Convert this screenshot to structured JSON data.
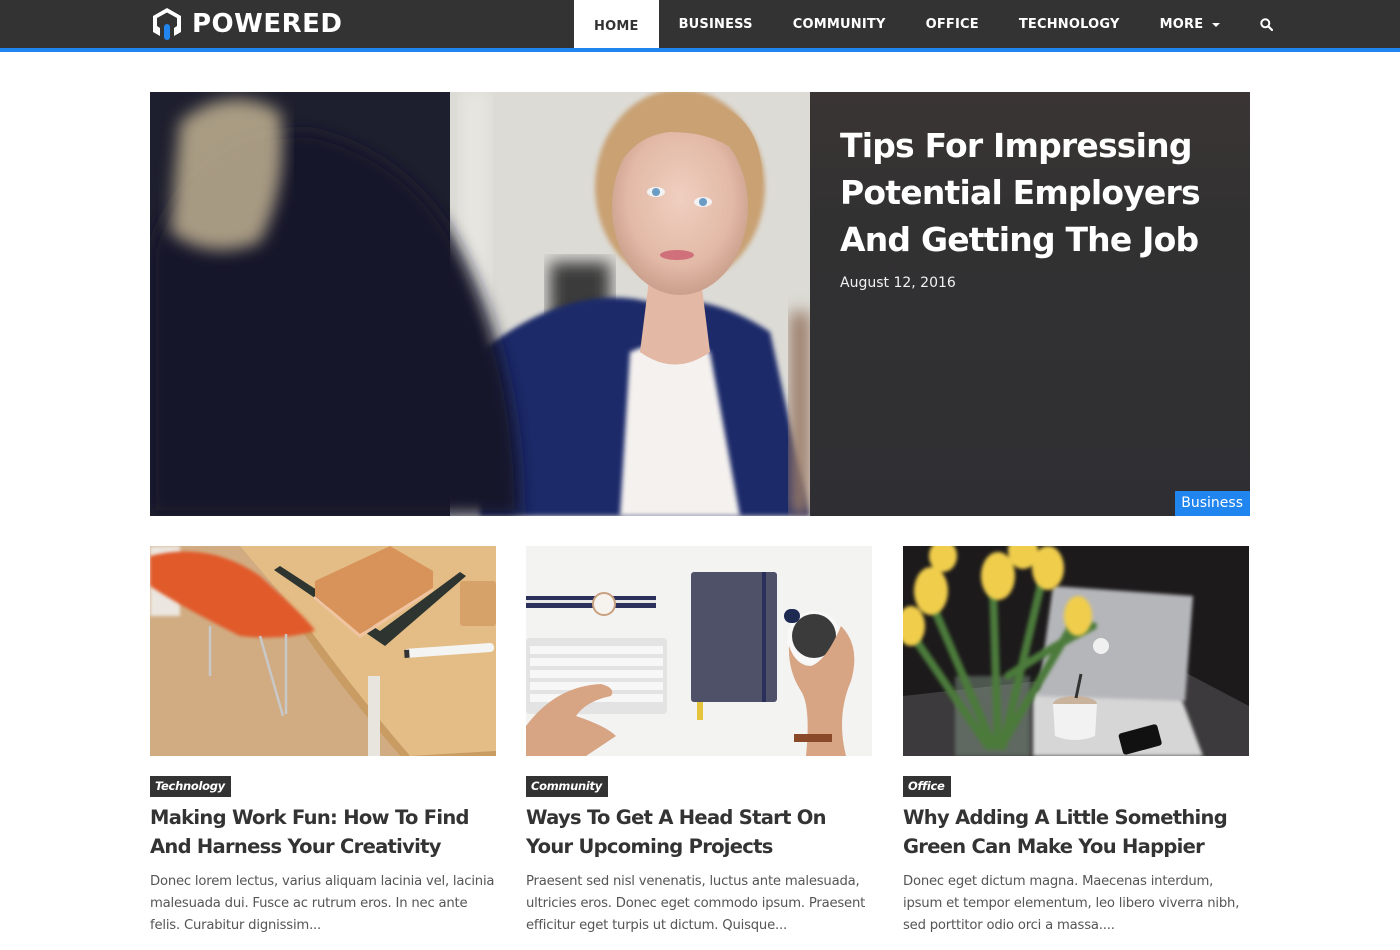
{
  "site": {
    "logo_text": "POWERED",
    "accent_color": "#2185f0",
    "header_bg": "#333333"
  },
  "nav": {
    "items": [
      {
        "label": "HOME",
        "active": true
      },
      {
        "label": "BUSINESS",
        "active": false
      },
      {
        "label": "COMMUNITY",
        "active": false
      },
      {
        "label": "OFFICE",
        "active": false
      },
      {
        "label": "TECHNOLOGY",
        "active": false
      },
      {
        "label": "MORE",
        "active": false,
        "has_dropdown": true
      }
    ],
    "search_icon": "search-icon",
    "dropdown_icon": "caret-down-icon"
  },
  "hero": {
    "image": "photo-woman-in-job-interview",
    "title": "Tips For Impressing Potential Employers And Getting The Job",
    "date": "August 12, 2016",
    "category": "Business"
  },
  "cards": [
    {
      "image": "photo-orange-chair-and-wooden-desk",
      "category": "Technology",
      "title": "Making Work Fun: How To Find And Harness Your Creativity",
      "excerpt": "Donec lorem lectus, varius aliquam lacinia vel, lacinia malesuada dui. Fusce ac rutrum eros. In nec ante felis. Curabitur dignissim..."
    },
    {
      "image": "photo-keyboard-notebook-coffee",
      "category": "Community",
      "title": "Ways To Get A Head Start On Your Upcoming Projects",
      "excerpt": "Praesent sed nisl venenatis, luctus ante malesuada, ultricies eros. Donec eget commodo ipsum. Praesent efficitur eget turpis ut dictum. Quisque..."
    },
    {
      "image": "photo-yellow-tulips-and-laptop",
      "category": "Office",
      "title": "Why Adding A Little Something Green Can Make You Happier",
      "excerpt": "Donec eget dictum magna. Maecenas interdum, ipsum et tempor elementum, leo libero viverra nibh, sed porttitor odio orci a massa...."
    }
  ]
}
